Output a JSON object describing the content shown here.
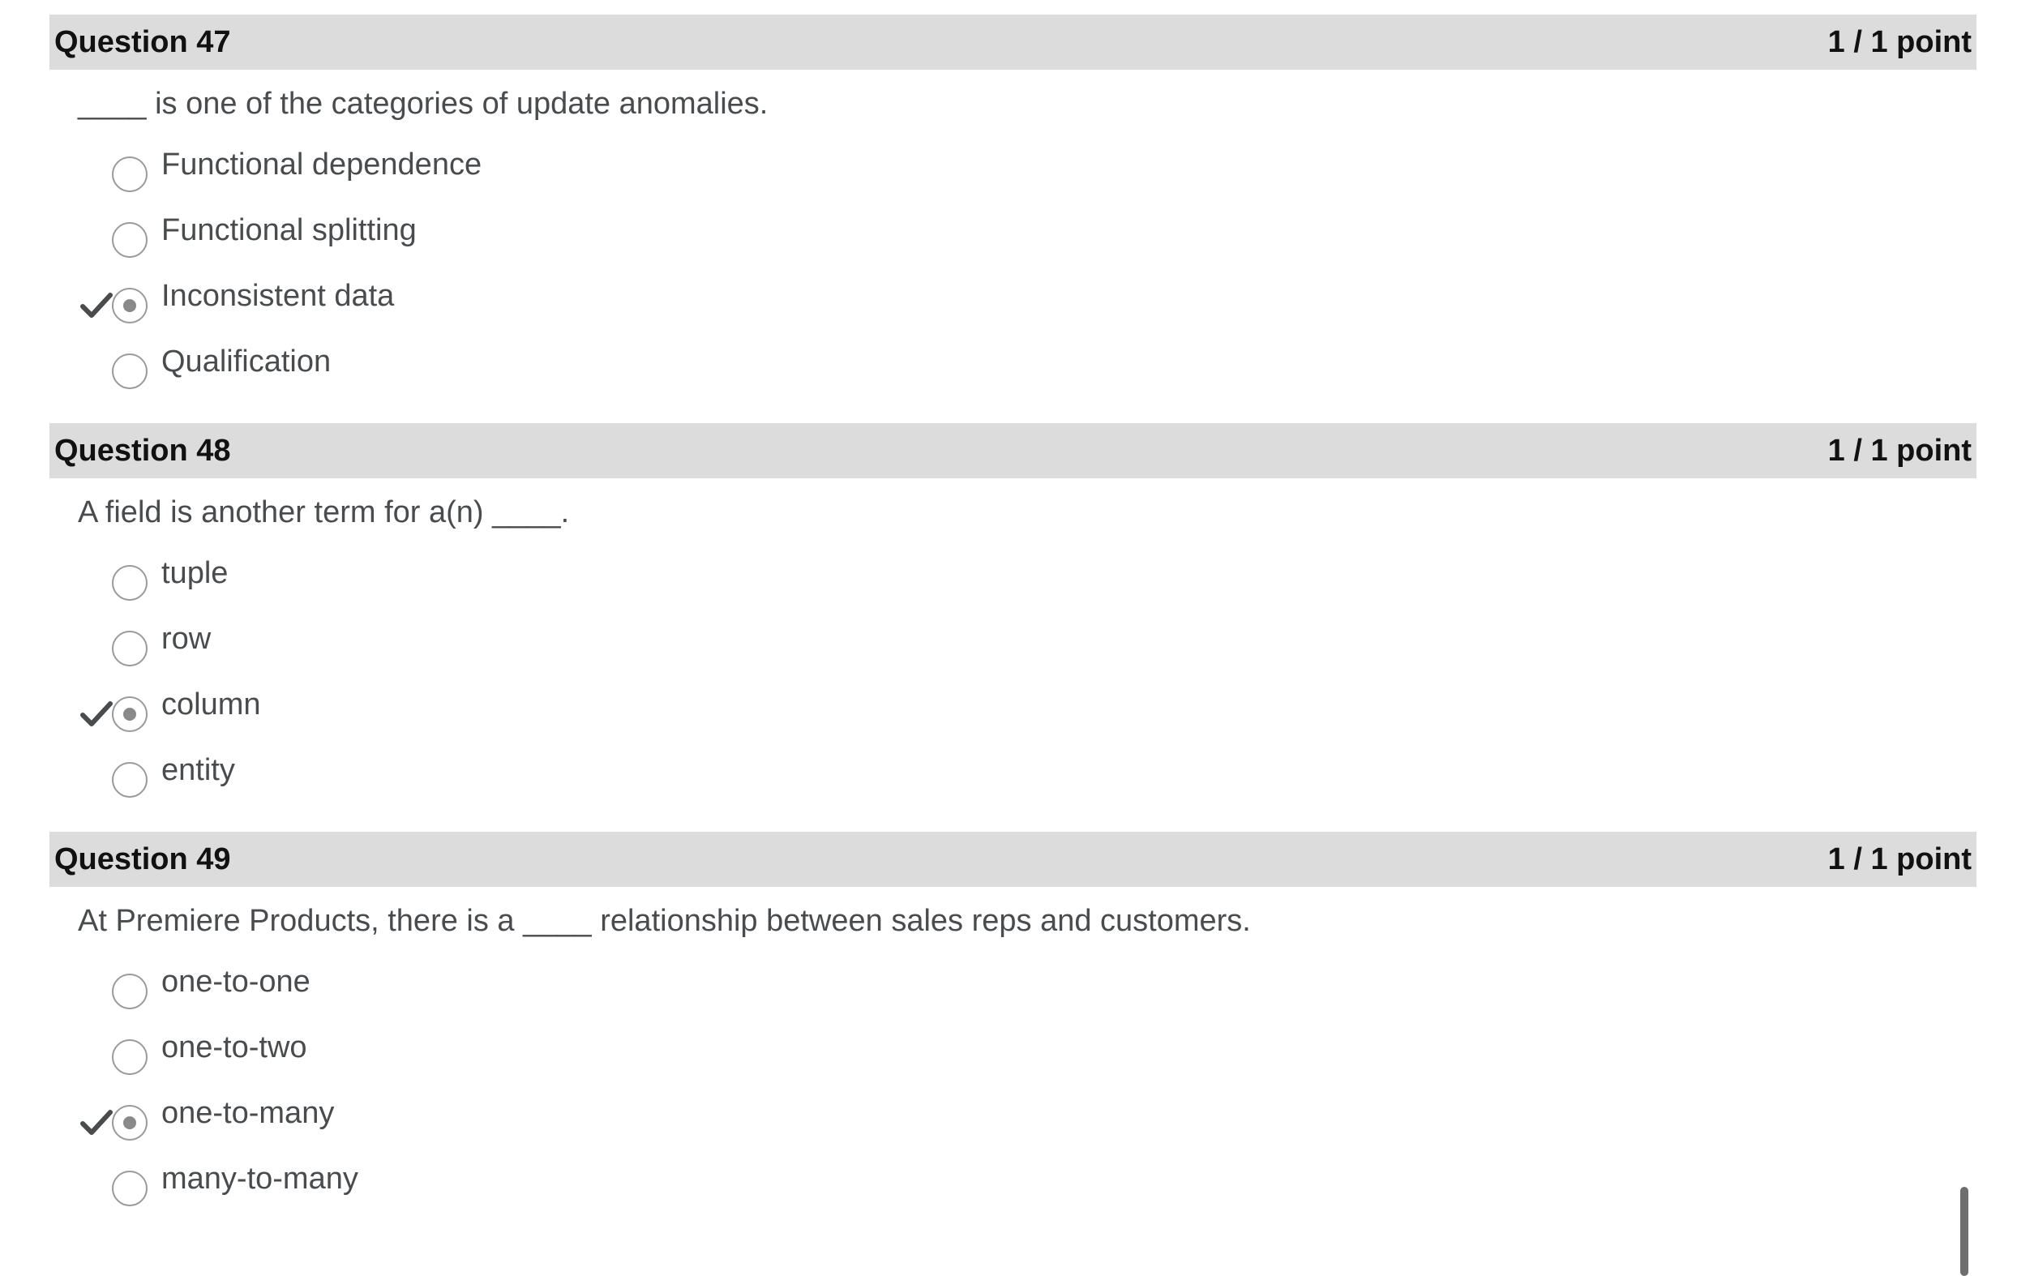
{
  "questions": [
    {
      "title": "Question 47",
      "score": "1 / 1 point",
      "prompt": "____ is one of the categories of update anomalies.",
      "options": [
        {
          "label": "Functional dependence",
          "selected": false,
          "correct": false
        },
        {
          "label": "Functional splitting",
          "selected": false,
          "correct": false
        },
        {
          "label": "Inconsistent data",
          "selected": true,
          "correct": true
        },
        {
          "label": "Qualification",
          "selected": false,
          "correct": false
        }
      ]
    },
    {
      "title": "Question 48",
      "score": "1 / 1 point",
      "prompt": "A field is another term for a(n) ____.",
      "options": [
        {
          "label": "tuple",
          "selected": false,
          "correct": false
        },
        {
          "label": "row",
          "selected": false,
          "correct": false
        },
        {
          "label": "column",
          "selected": true,
          "correct": true
        },
        {
          "label": "entity",
          "selected": false,
          "correct": false
        }
      ]
    },
    {
      "title": "Question 49",
      "score": "1 / 1 point",
      "prompt": "At Premiere Products, there is a ____ relationship between sales reps and customers.",
      "options": [
        {
          "label": "one-to-one",
          "selected": false,
          "correct": false
        },
        {
          "label": "one-to-two",
          "selected": false,
          "correct": false
        },
        {
          "label": "one-to-many",
          "selected": true,
          "correct": true
        },
        {
          "label": "many-to-many",
          "selected": false,
          "correct": false
        }
      ]
    }
  ],
  "icons": {
    "correct": "checkmark-icon",
    "radio": "radio-button"
  },
  "colors": {
    "header_bg": "#dcdcdc",
    "text": "#494c4e",
    "header_text": "#111111",
    "check": "#494c4e"
  }
}
